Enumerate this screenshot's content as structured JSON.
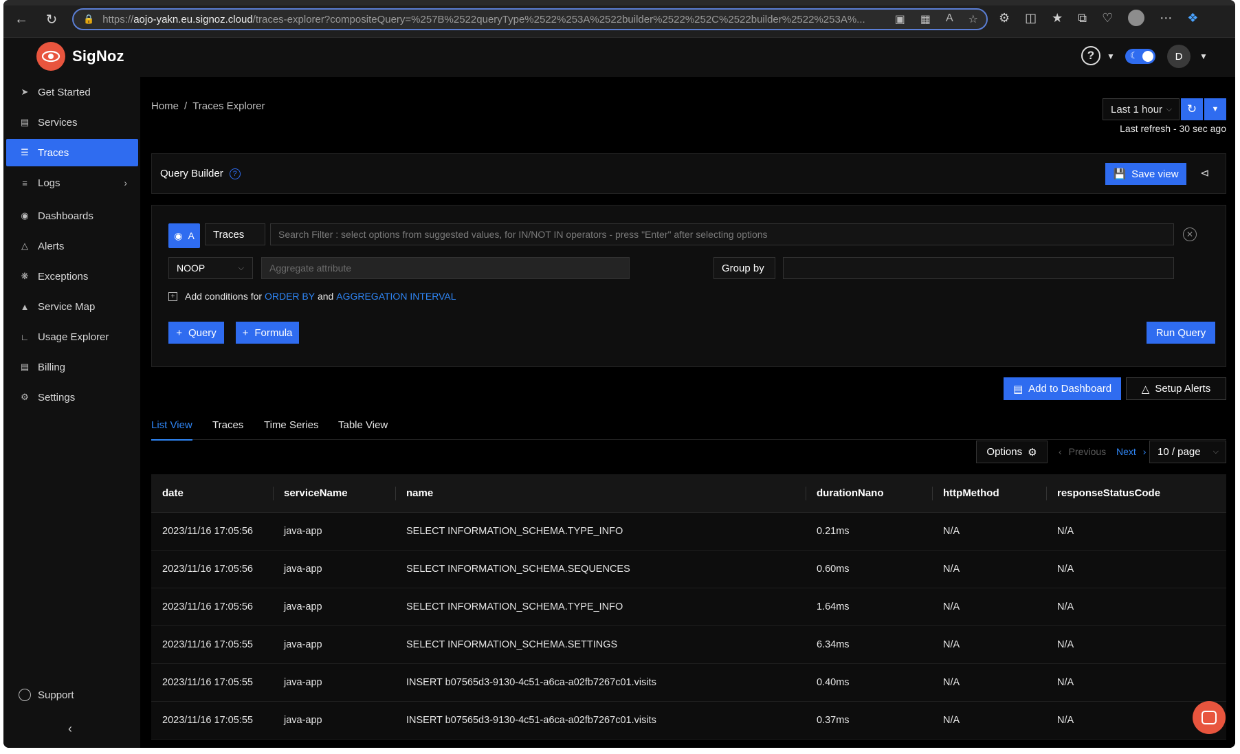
{
  "browser": {
    "url_prefix": "https://",
    "url_host": "aojo-yakn.eu.signoz.cloud",
    "url_path": "/traces-explorer?compositeQuery=%257B%2522queryType%2522%253A%2522builder%2522%252C%2522builder%2522%253A%..."
  },
  "app": {
    "name": "SigNoz",
    "user_initial": "D"
  },
  "sidebar": {
    "items": [
      {
        "label": "Get Started",
        "icon": "rocket-icon"
      },
      {
        "label": "Services",
        "icon": "bar-chart-icon"
      },
      {
        "label": "Traces",
        "icon": "menu-icon"
      },
      {
        "label": "Logs",
        "icon": "align-left-icon"
      },
      {
        "label": "Dashboards",
        "icon": "dashboard-icon"
      },
      {
        "label": "Alerts",
        "icon": "bell-icon"
      },
      {
        "label": "Exceptions",
        "icon": "bug-icon"
      },
      {
        "label": "Service Map",
        "icon": "deployment-icon"
      },
      {
        "label": "Usage Explorer",
        "icon": "line-chart-icon"
      },
      {
        "label": "Billing",
        "icon": "file-icon"
      },
      {
        "label": "Settings",
        "icon": "gear-icon"
      }
    ],
    "active": "Traces",
    "support_label": "Support"
  },
  "breadcrumb": {
    "home": "Home",
    "sep": "/",
    "current": "Traces Explorer"
  },
  "time": {
    "range": "Last 1 hour",
    "last_refresh": "Last refresh - 30 sec ago"
  },
  "query_builder": {
    "title": "Query Builder",
    "save_view": "Save view",
    "query_letter": "A",
    "data_source": "Traces",
    "search_placeholder": "Search Filter : select options from suggested values, for IN/NOT IN operators - press \"Enter\" after selecting options",
    "aggregate_operator": "NOOP",
    "aggregate_attr_placeholder": "Aggregate attribute",
    "group_by_label": "Group by",
    "conditions_prefix": "Add conditions for",
    "conditions_order_by": "ORDER BY",
    "conditions_and": "and",
    "conditions_interval": "AGGREGATION INTERVAL",
    "add_query": "Query",
    "add_formula": "Formula",
    "run_query": "Run Query"
  },
  "actions": {
    "add_to_dashboard": "Add to Dashboard",
    "setup_alerts": "Setup Alerts"
  },
  "view_tabs": [
    "List View",
    "Traces",
    "Time Series",
    "Table View"
  ],
  "pagination": {
    "options": "Options",
    "previous": "Previous",
    "next": "Next",
    "page_size": "10 / page"
  },
  "table": {
    "columns": [
      "date",
      "serviceName",
      "name",
      "durationNano",
      "httpMethod",
      "responseStatusCode"
    ],
    "rows": [
      [
        "2023/11/16 17:05:56",
        "java-app",
        "SELECT INFORMATION_SCHEMA.TYPE_INFO",
        "0.21ms",
        "N/A",
        "N/A"
      ],
      [
        "2023/11/16 17:05:56",
        "java-app",
        "SELECT INFORMATION_SCHEMA.SEQUENCES",
        "0.60ms",
        "N/A",
        "N/A"
      ],
      [
        "2023/11/16 17:05:56",
        "java-app",
        "SELECT INFORMATION_SCHEMA.TYPE_INFO",
        "1.64ms",
        "N/A",
        "N/A"
      ],
      [
        "2023/11/16 17:05:55",
        "java-app",
        "SELECT INFORMATION_SCHEMA.SETTINGS",
        "6.34ms",
        "N/A",
        "N/A"
      ],
      [
        "2023/11/16 17:05:55",
        "java-app",
        "INSERT b07565d3-9130-4c51-a6ca-a02fb7267c01.visits",
        "0.40ms",
        "N/A",
        "N/A"
      ],
      [
        "2023/11/16 17:05:55",
        "java-app",
        "INSERT b07565d3-9130-4c51-a6ca-a02fb7267c01.visits",
        "0.37ms",
        "N/A",
        "N/A"
      ]
    ]
  },
  "colors": {
    "accent": "#2f6cf0",
    "link": "#2f86f6",
    "brand": "#e8553e"
  }
}
